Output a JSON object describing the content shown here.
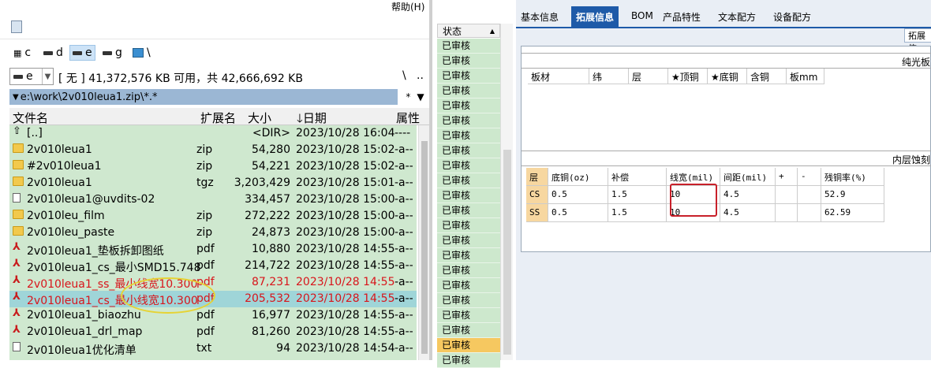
{
  "left": {
    "menu_help": "帮助(H)",
    "drives": [
      "c",
      "d",
      "e",
      "g",
      "\\"
    ],
    "selected_drive": "e",
    "combo_value": "e",
    "free_info": "[ 无 ]  41,372,576 KB 可用，共 42,666,692 KB",
    "path": "e:\\work\\2v010leua1.zip\\*.*",
    "path_btns": [
      "\\",
      ".."
    ],
    "path_right": [
      "*",
      "▼"
    ],
    "columns": [
      "文件名",
      "扩展名",
      "大小",
      "日期",
      "属性"
    ],
    "files": [
      {
        "icon": "up",
        "name": "[..]",
        "ext": "",
        "size": "<DIR>",
        "date": "2023/10/28 16:04",
        "attr": "----"
      },
      {
        "icon": "folder",
        "name": "2v010leua1",
        "ext": "zip",
        "size": "54,280",
        "date": "2023/10/28 15:02",
        "attr": "-a--"
      },
      {
        "icon": "folder",
        "name": "#2v010leua1",
        "ext": "zip",
        "size": "54,221",
        "date": "2023/10/28 15:02",
        "attr": "-a--"
      },
      {
        "icon": "folder",
        "name": "2v010leua1",
        "ext": "tgz",
        "size": "3,203,429",
        "date": "2023/10/28 15:01",
        "attr": "-a--"
      },
      {
        "icon": "file",
        "name": "2v010leua1@uvdits-02",
        "ext": "",
        "size": "334,457",
        "date": "2023/10/28 15:00",
        "attr": "-a--"
      },
      {
        "icon": "folder",
        "name": "2v010leu_film",
        "ext": "zip",
        "size": "272,222",
        "date": "2023/10/28 15:00",
        "attr": "-a--"
      },
      {
        "icon": "folder",
        "name": "2v010leu_paste",
        "ext": "zip",
        "size": "24,873",
        "date": "2023/10/28 15:00",
        "attr": "-a--"
      },
      {
        "icon": "pdf",
        "name": "2v010leua1_垫板拆卸图纸",
        "ext": "pdf",
        "size": "10,880",
        "date": "2023/10/28 14:55",
        "attr": "-a--"
      },
      {
        "icon": "pdf",
        "name": "2v010leua1_cs_最小SMD15.748",
        "ext": "pdf",
        "size": "214,722",
        "date": "2023/10/28 14:55",
        "attr": "-a--"
      },
      {
        "icon": "pdf",
        "name": "2v010leua1_ss_最小线宽10.300",
        "ext": "pdf",
        "size": "87,231",
        "date": "2023/10/28 14:55",
        "attr": "-a--",
        "red": true
      },
      {
        "icon": "pdf",
        "name": "2v010leua1_cs_最小线宽10.300",
        "ext": "pdf",
        "size": "205,532",
        "date": "2023/10/28 14:55",
        "attr": "-a--",
        "red": true,
        "selected": true
      },
      {
        "icon": "pdf",
        "name": "2v010leua1_biaozhu",
        "ext": "pdf",
        "size": "16,977",
        "date": "2023/10/28 14:55",
        "attr": "-a--"
      },
      {
        "icon": "pdf",
        "name": "2v010leua1_drl_map",
        "ext": "pdf",
        "size": "81,260",
        "date": "2023/10/28 14:55",
        "attr": "-a--"
      },
      {
        "icon": "file",
        "name": "2v010leua1优化清单",
        "ext": "txt",
        "size": "94",
        "date": "2023/10/28 14:54",
        "attr": "-a--"
      }
    ]
  },
  "mid": {
    "header": "状态",
    "status": [
      "已审核",
      "已审核",
      "已审核",
      "已审核",
      "已审核",
      "已审核",
      "已审核",
      "已审核",
      "已审核",
      "已审核",
      "已审核",
      "已审核",
      "已审核",
      "已审核",
      "已审核",
      "已审核",
      "已审核",
      "已审核",
      "已审核",
      "已审核",
      "已审核",
      "已审核"
    ],
    "current_index": 20
  },
  "right": {
    "tabs": [
      "基本信息",
      "拓展信息",
      "BOM",
      "产品特性",
      "文本配方",
      "设备配方"
    ],
    "active_tab": "拓展信息",
    "subtab": "拓展信",
    "section1_title": "纯光板",
    "grid1_cols": [
      "板材",
      "纬",
      "层",
      "★顶铜",
      "★底铜",
      "含铜",
      "板mm"
    ],
    "section2_title": "内层蚀刻",
    "grid2_cols": [
      "层",
      "底铜(oz)",
      "补偿",
      "线宽(mil)",
      "间距(mil)",
      "+",
      "-",
      "残铜率(%)"
    ],
    "grid2_rows": [
      [
        "CS",
        "0.5",
        "1.5",
        "10",
        "4.5",
        "",
        "",
        "52.9"
      ],
      [
        "SS",
        "0.5",
        "1.5",
        "10",
        "4.5",
        "",
        "",
        "62.59"
      ]
    ]
  }
}
